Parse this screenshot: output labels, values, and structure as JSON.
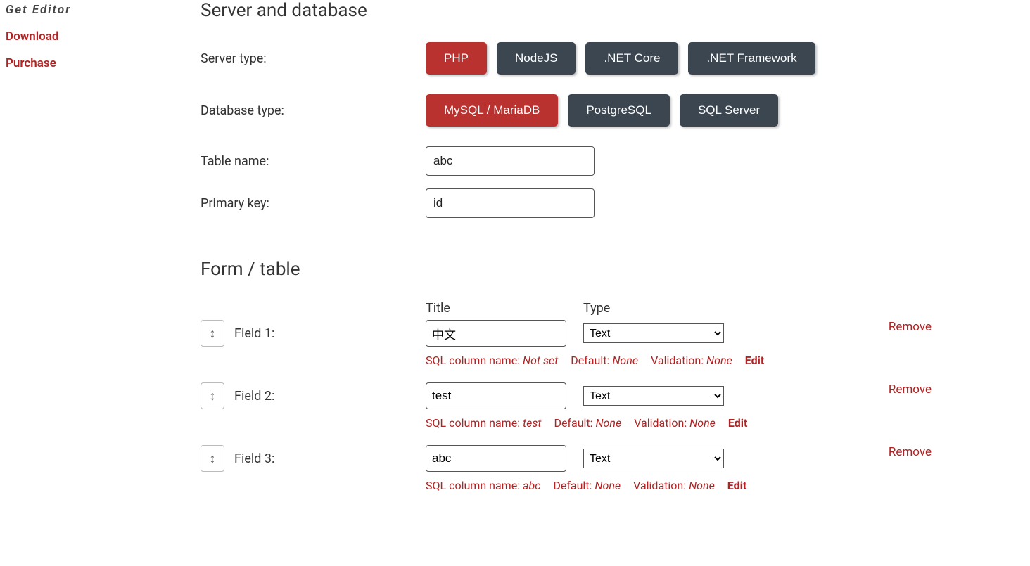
{
  "sidebar": {
    "current": "Get Editor",
    "links": [
      "Download",
      "Purchase"
    ]
  },
  "sections": {
    "server_db": "Server and database",
    "form_table": "Form / table"
  },
  "labels": {
    "server_type": "Server type:",
    "database_type": "Database type:",
    "table_name": "Table name:",
    "primary_key": "Primary key:",
    "title_col": "Title",
    "type_col": "Type",
    "sql_col": "SQL column name:",
    "default": "Default:",
    "validation": "Validation:",
    "edit": "Edit",
    "remove": "Remove"
  },
  "server_types": [
    {
      "label": "PHP",
      "selected": true
    },
    {
      "label": "NodeJS",
      "selected": false
    },
    {
      "label": ".NET Core",
      "selected": false
    },
    {
      "label": ".NET Framework",
      "selected": false
    }
  ],
  "database_types": [
    {
      "label": "MySQL / MariaDB",
      "selected": true
    },
    {
      "label": "PostgreSQL",
      "selected": false
    },
    {
      "label": "SQL Server",
      "selected": false
    }
  ],
  "table_name": "abc",
  "primary_key": "id",
  "type_options": [
    "Text"
  ],
  "fields": [
    {
      "label": "Field 1:",
      "title": "中文",
      "type": "Text",
      "sql_col": "Not set",
      "default": "None",
      "validation": "None"
    },
    {
      "label": "Field 2:",
      "title": "test",
      "type": "Text",
      "sql_col": "test",
      "default": "None",
      "validation": "None"
    },
    {
      "label": "Field 3:",
      "title": "abc",
      "type": "Text",
      "sql_col": "abc",
      "default": "None",
      "validation": "None"
    }
  ]
}
